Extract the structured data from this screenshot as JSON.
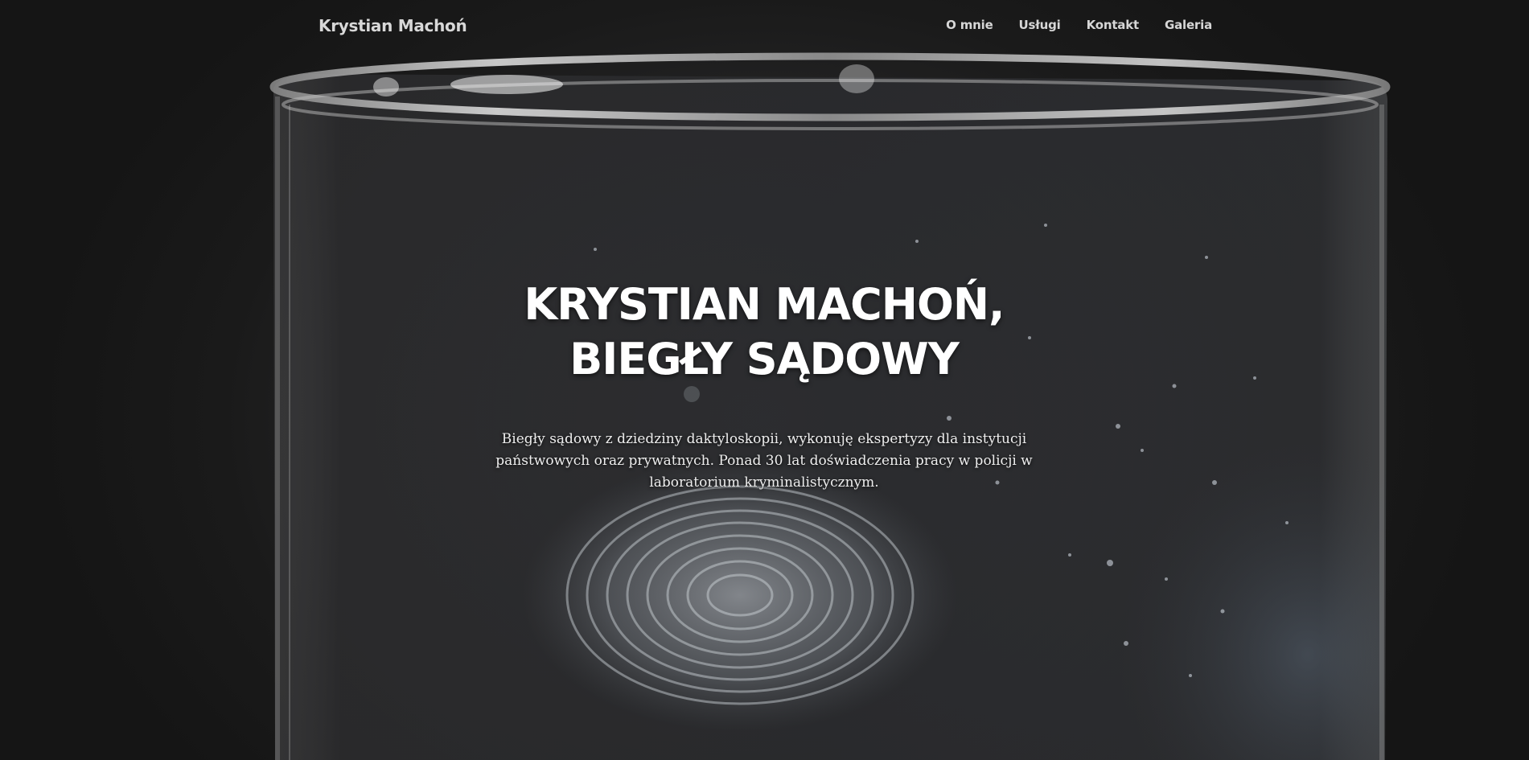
{
  "nav": {
    "brand": "Krystian Machoń",
    "items": [
      {
        "label": "O mnie"
      },
      {
        "label": "Usługi"
      },
      {
        "label": "Kontakt"
      },
      {
        "label": "Galeria"
      }
    ]
  },
  "hero": {
    "title_line1": "KRYSTIAN MACHOŃ,",
    "title_line2": "BIEGŁY SĄDOWY",
    "lead": "Biegły sądowy z dziedziny daktyloskopii, wykonuję ekspertyzy dla instytucji państwowych oraz prywatnych. Ponad 30 lat doświadczenia pracy w policji w laboratorium kryminalistycznym."
  },
  "colors": {
    "background": "#1b1b1b",
    "text": "#ffffff",
    "nav_text": "#d6d6d6"
  }
}
